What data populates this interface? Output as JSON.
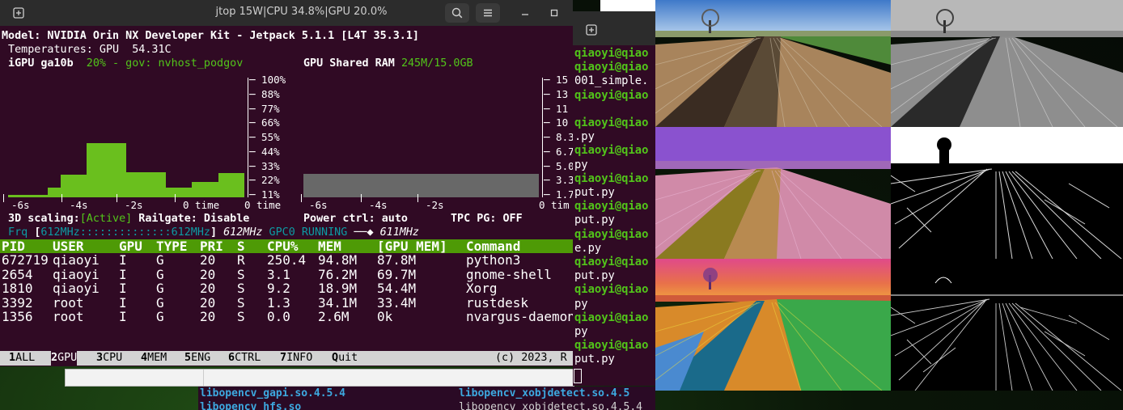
{
  "window": {
    "title": "jtop 15W|CPU 34.8%|GPU 20.0%",
    "buttons": [
      "new-tab",
      "search",
      "menu",
      "minimize",
      "maximize",
      "close"
    ]
  },
  "jtop": {
    "model_line": "Model: NVIDIA Orin NX Developer Kit - Jetpack 5.1.1 [L4T 35.3.1]",
    "temperatures": " Temperatures: GPU  54.31C",
    "igpu_label": " iGPU ga10b",
    "igpu_status": "  20% - gov: nvhost_podgov",
    "shared_ram_label": "GPU Shared RAM",
    "shared_ram_value": "245M/15.0GB",
    "gpu_graph": {
      "y_ticks": [
        "100%",
        "88%",
        "77%",
        "66%",
        "55%",
        "44%",
        "33%",
        "22%",
        "11%"
      ],
      "x_ticks": [
        "-6s",
        "-4s",
        "-2s",
        "0 time"
      ],
      "load_series": [
        2,
        2,
        2,
        8,
        19,
        19,
        45,
        45,
        45,
        21,
        21,
        21,
        8,
        8,
        13,
        13,
        20,
        20
      ],
      "color": "#6abf1e"
    },
    "ram_graph": {
      "y_ticks": [
        "15",
        "13",
        "11",
        "10",
        "8.3",
        "6.7",
        "5.0",
        "3.3",
        "1.7"
      ],
      "x_ticks": [
        "-6s",
        "-4s",
        "-2s",
        "0 tim"
      ],
      "used_gb": 0.245,
      "color": "#686868"
    },
    "scaling_line": {
      "label": " 3D scaling:",
      "value": "[Active]",
      "railgate": " Railgate: Disable",
      "power_ctrl": "Power ctrl: auto",
      "tpc_pg": "TPC PG: OFF"
    },
    "freq_line": {
      "label": " Frq ",
      "bracket_open": "[",
      "bar_text": "612MHz::::::::::::::612MHz",
      "bracket_close": "]",
      "current": " 612MHz",
      "gpc_label": " GPC0 RUNNING ",
      "gpc_freq": "611MHz"
    },
    "process_table": {
      "headers": [
        "PID",
        "USER",
        "GPU",
        "TYPE",
        "PRI",
        "S",
        "CPU%",
        "MEM",
        "[GPU MEM]",
        "Command"
      ],
      "rows": [
        [
          "672719",
          "qiaoyi",
          "I",
          "G",
          "20",
          "R",
          "250.4",
          "94.8M",
          "87.8M",
          "python3"
        ],
        [
          "2654",
          "qiaoyi",
          "I",
          "G",
          "20",
          "S",
          "3.1",
          "76.2M",
          "69.7M",
          "gnome-shell"
        ],
        [
          "1810",
          "qiaoyi",
          "I",
          "G",
          "20",
          "S",
          "9.2",
          "18.9M",
          "54.4M",
          "Xorg"
        ],
        [
          "3392",
          "root",
          "I",
          "G",
          "20",
          "S",
          "1.3",
          "34.1M",
          "33.4M",
          "rustdesk"
        ],
        [
          "1356",
          "root",
          "I",
          "G",
          "20",
          "S",
          "0.0",
          "2.6M",
          "0k",
          "nvargus-daemon"
        ]
      ]
    },
    "menu": {
      "tabs": [
        {
          "key": "1",
          "label": "ALL"
        },
        {
          "key": "2",
          "label": "GPU",
          "selected": true
        },
        {
          "key": "3",
          "label": "CPU"
        },
        {
          "key": "4",
          "label": "MEM"
        },
        {
          "key": "5",
          "label": "ENG"
        },
        {
          "key": "6",
          "label": "CTRL"
        },
        {
          "key": "7",
          "label": "INFO"
        },
        {
          "key": "Q",
          "label": "uit"
        }
      ],
      "copyright": "(c) 2023, R"
    }
  },
  "terminal2": {
    "lines": [
      {
        "t": "qiaoyi@qiao",
        "prompt": true
      },
      {
        "t": "qiaoyi@qiao",
        "prompt": true
      },
      {
        "t": "001_simple.",
        "prompt": false
      },
      {
        "t": "qiaoyi@qiao",
        "prompt": true
      },
      {
        "t": "",
        "prompt": false
      },
      {
        "t": "qiaoyi@qiao",
        "prompt": true
      },
      {
        "t": ".py",
        "prompt": false
      },
      {
        "t": "qiaoyi@qiao",
        "prompt": true
      },
      {
        "t": "py",
        "prompt": false
      },
      {
        "t": "qiaoyi@qiao",
        "prompt": true
      },
      {
        "t": "put.py",
        "prompt": false
      },
      {
        "t": "qiaoyi@qiao",
        "prompt": true
      },
      {
        "t": "put.py",
        "prompt": false
      },
      {
        "t": "qiaoyi@qiao",
        "prompt": true
      },
      {
        "t": "e.py",
        "prompt": false
      },
      {
        "t": "qiaoyi@qiao",
        "prompt": true
      },
      {
        "t": "put.py",
        "prompt": false
      },
      {
        "t": "qiaoyi@qiao",
        "prompt": true
      },
      {
        "t": "py",
        "prompt": false
      },
      {
        "t": "qiaoyi@qiao",
        "prompt": true
      },
      {
        "t": "py",
        "prompt": false
      },
      {
        "t": "qiaoyi@qiao",
        "prompt": true
      },
      {
        "t": "put.py",
        "prompt": false
      }
    ]
  },
  "background_terminal": {
    "line1_left": "libopencv_gapi.so.4.5.4",
    "line1_right": "libopencv_xobjdetect.so.4.5",
    "line2_left": "libopencv_hfs.so",
    "line2_right": "libopencv_xobjdetect.so.4.5.4"
  },
  "image_panels": [
    {
      "name": "original-image",
      "style": "color"
    },
    {
      "name": "grayscale-image",
      "style": "gray"
    },
    {
      "name": "hsv-image",
      "style": "hsv"
    },
    {
      "name": "threshold-image",
      "style": "binary"
    },
    {
      "name": "lab-image",
      "style": "lab"
    },
    {
      "name": "edges-image",
      "style": "edges"
    }
  ]
}
